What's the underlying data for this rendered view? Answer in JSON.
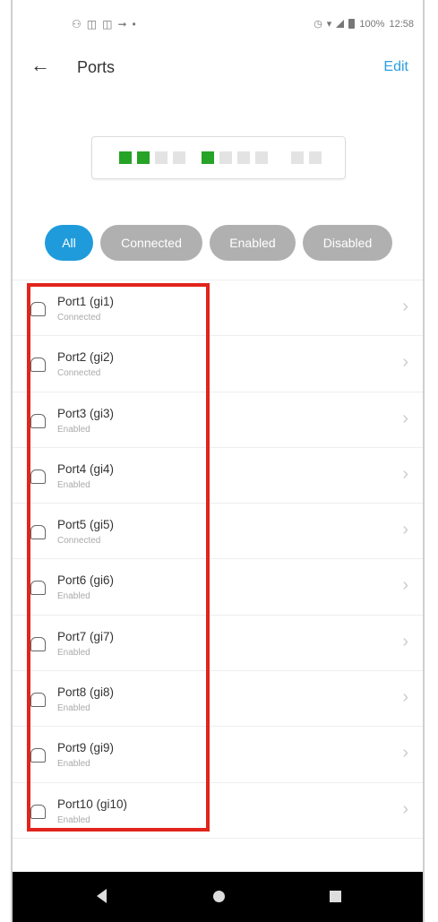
{
  "status_bar": {
    "left_icons": [
      "notification-icon",
      "sim-icon",
      "sim-icon",
      "cast-icon",
      "dot-icon"
    ],
    "right_icons": [
      "alarm-icon",
      "wifi-icon",
      "signal-icon",
      "battery-icon"
    ],
    "battery": "100%",
    "time": "12:58"
  },
  "appbar": {
    "back_icon": "arrow-left-icon",
    "title": "Ports",
    "edit_label": "Edit"
  },
  "port_map": {
    "ports": [
      "connected",
      "connected",
      "idle",
      "idle",
      "connected",
      "idle",
      "idle",
      "idle",
      "idle",
      "idle"
    ],
    "colors": {
      "connected": "#27a327",
      "idle": "#e3e3e3"
    }
  },
  "filters": {
    "selected": "All",
    "items": [
      {
        "label": "All"
      },
      {
        "label": "Connected"
      },
      {
        "label": "Enabled"
      },
      {
        "label": "Disabled"
      }
    ],
    "colors": {
      "active": "#1f9bdb",
      "inactive": "#b0b0b0"
    }
  },
  "ports": [
    {
      "name": "Port1 (gi1)",
      "status": "Connected"
    },
    {
      "name": "Port2 (gi2)",
      "status": "Connected"
    },
    {
      "name": "Port3 (gi3)",
      "status": "Enabled"
    },
    {
      "name": "Port4 (gi4)",
      "status": "Enabled"
    },
    {
      "name": "Port5 (gi5)",
      "status": "Connected"
    },
    {
      "name": "Port6 (gi6)",
      "status": "Enabled"
    },
    {
      "name": "Port7 (gi7)",
      "status": "Enabled"
    },
    {
      "name": "Port8 (gi8)",
      "status": "Enabled"
    },
    {
      "name": "Port9 (gi9)",
      "status": "Enabled"
    },
    {
      "name": "Port10 (gi10)",
      "status": "Enabled"
    }
  ],
  "highlight_color": "#e1241c",
  "nav_bar": [
    "back-triangle-icon",
    "home-circle-icon",
    "recents-square-icon"
  ]
}
